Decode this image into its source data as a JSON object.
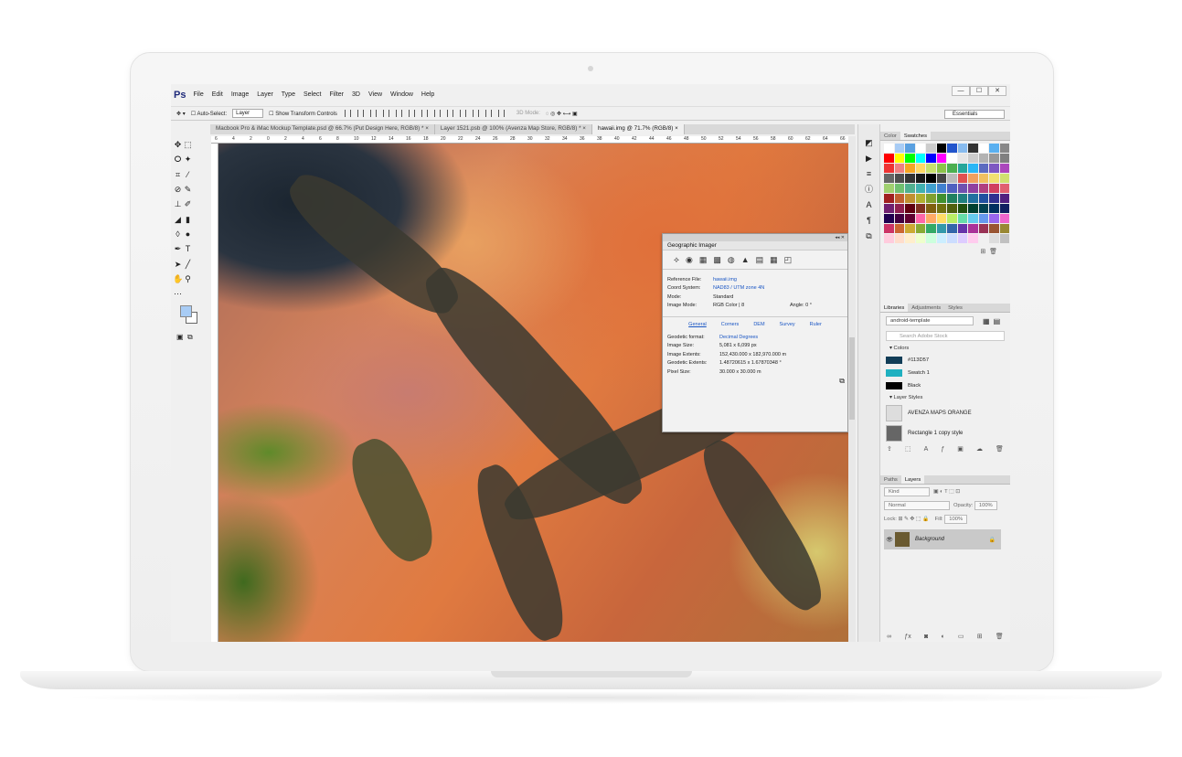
{
  "app": {
    "logo": "Ps"
  },
  "menu": [
    "File",
    "Edit",
    "Image",
    "Layer",
    "Type",
    "Select",
    "Filter",
    "3D",
    "View",
    "Window",
    "Help"
  ],
  "window_controls": [
    "—",
    "☐",
    "✕"
  ],
  "options": {
    "auto_select_label": "Auto-Select:",
    "auto_select_value": "Layer",
    "transform_label": "Show Transform Controls",
    "mode_3d": "3D Mode:",
    "workspace": "Essentials"
  },
  "tabs": [
    {
      "label": "Macbook Pro & iMac Mockup Template.psd @ 66.7% (Put Design Here, RGB/8) *",
      "close": "×"
    },
    {
      "label": "Layer 1521.psb @ 100% (Avenza Map Store, RGB/8) *",
      "close": "×"
    },
    {
      "label": "hawaii.img @ 71.7% (RGB/8)",
      "close": "×"
    }
  ],
  "ruler_top": [
    "6",
    "4",
    "2",
    "0",
    "2",
    "4",
    "6",
    "8",
    "10",
    "12",
    "14",
    "16",
    "18",
    "20",
    "22",
    "24",
    "26",
    "28",
    "30",
    "32",
    "34",
    "36",
    "38",
    "40",
    "42",
    "44",
    "46",
    "48",
    "50",
    "52",
    "54",
    "56",
    "58",
    "60",
    "62",
    "64",
    "66"
  ],
  "geo_imager": {
    "title": "Geographic Imager",
    "fields": [
      {
        "label": "Reference File:",
        "value": "hawaii.img",
        "link": true
      },
      {
        "label": "Coord System:",
        "value": "NAD83 / UTM zone 4N",
        "link": true
      },
      {
        "label": "Mode:",
        "value": "Standard",
        "link": false
      },
      {
        "label": "Image Mode:",
        "value": "RGB Color | 8",
        "link": false
      }
    ],
    "angle_label": "Angle:",
    "angle_value": "0 °",
    "tabs": [
      "General",
      "Corners",
      "DEM",
      "Survey",
      "Ruler"
    ],
    "details": [
      {
        "label": "Geodetic format:",
        "value": "Decimal Degrees",
        "link": true
      },
      {
        "label": "Image Size:",
        "value": "5,081 x 6,099 px",
        "link": false
      },
      {
        "label": "Image Extents:",
        "value": "152,430.000 x 182,970.000 m",
        "link": false
      },
      {
        "label": "Geodetic Extents:",
        "value": "1.48720615 x 1.67870348 °",
        "link": false
      },
      {
        "label": "Pixel Size:",
        "value": "30.000 x 30.000 m",
        "link": false
      }
    ]
  },
  "swatch_panel": {
    "tabs": [
      "Color",
      "Swatches"
    ]
  },
  "swatch_colors": [
    "#ffffff",
    "#a8ccf5",
    "#5aa0e0",
    "#ffffff",
    "#cccccc",
    "#000000",
    "#2255cc",
    "#88bbee",
    "#333333",
    "#ffffff",
    "#5ab0f0",
    "#888888",
    "#ff0000",
    "#ffff00",
    "#00ff00",
    "#00ffff",
    "#0000ff",
    "#ff00ff",
    "#ffffff",
    "#e6e6e6",
    "#cccccc",
    "#b3b3b3",
    "#999999",
    "#808080",
    "#ee3333",
    "#f08080",
    "#f5a623",
    "#ffd966",
    "#c8e06e",
    "#8bc34a",
    "#4caf50",
    "#26a69a",
    "#29b6f6",
    "#5c6bc0",
    "#7e57c2",
    "#ab47bc",
    "#666666",
    "#4d4d4d",
    "#333333",
    "#1a1a1a",
    "#000000",
    "#444444",
    "#bbbbbb",
    "#e05050",
    "#f0a060",
    "#f0c060",
    "#f0e070",
    "#d0e070",
    "#a0d070",
    "#70c070",
    "#50b090",
    "#40b0b0",
    "#40a0d0",
    "#4080d0",
    "#5060c0",
    "#7050b0",
    "#9040a0",
    "#b04080",
    "#d04060",
    "#e06070",
    "#a02020",
    "#c06030",
    "#c09030",
    "#b0b030",
    "#80a030",
    "#409030",
    "#208060",
    "#208080",
    "#2070a0",
    "#2050a0",
    "#303090",
    "#502080",
    "#702070",
    "#902050",
    "#600010",
    "#803020",
    "#806010",
    "#707010",
    "#506010",
    "#205010",
    "#004030",
    "#004050",
    "#003060",
    "#102060",
    "#200050",
    "#400040",
    "#600030",
    "#ff66aa",
    "#ffaa66",
    "#ffdd66",
    "#bbee66",
    "#66ddaa",
    "#66ccee",
    "#6699ee",
    "#9966ee",
    "#ee66cc",
    "#cc3366",
    "#cc6633",
    "#ccaa33",
    "#88aa33",
    "#33aa66",
    "#3399aa",
    "#3366aa",
    "#6633aa",
    "#aa3399",
    "#993355",
    "#995533",
    "#998833",
    "#ffccdd",
    "#ffddcc",
    "#ffeecc",
    "#eeffcc",
    "#ccffdd",
    "#cceeff",
    "#ccddff",
    "#ddccff",
    "#ffccee",
    "#f0f0f0",
    "#dddddd",
    "#c0c0c0"
  ],
  "libraries": {
    "tabs": [
      "Libraries",
      "Adjustments",
      "Styles"
    ],
    "library": "android-template",
    "search_placeholder": "Search Adobe Stock",
    "colors_heading": "Colors",
    "colors": [
      {
        "name": "#113D57",
        "hex": "#113D57"
      },
      {
        "name": "Swatch 1",
        "hex": "#1fb0c0"
      },
      {
        "name": "Black",
        "hex": "#000000"
      }
    ],
    "styles_heading": "Layer Styles",
    "styles": [
      "AVENZA MAPS ORANGE",
      "Rectangle 1 copy style"
    ]
  },
  "layers": {
    "tabs": [
      "Paths",
      "Layers"
    ],
    "kind": "Kind",
    "blend": "Normal",
    "opacity_label": "Opacity:",
    "opacity": "100%",
    "lock_label": "Lock:",
    "fill_label": "Fill:",
    "fill": "100%",
    "items": [
      {
        "name": "Background"
      }
    ]
  }
}
